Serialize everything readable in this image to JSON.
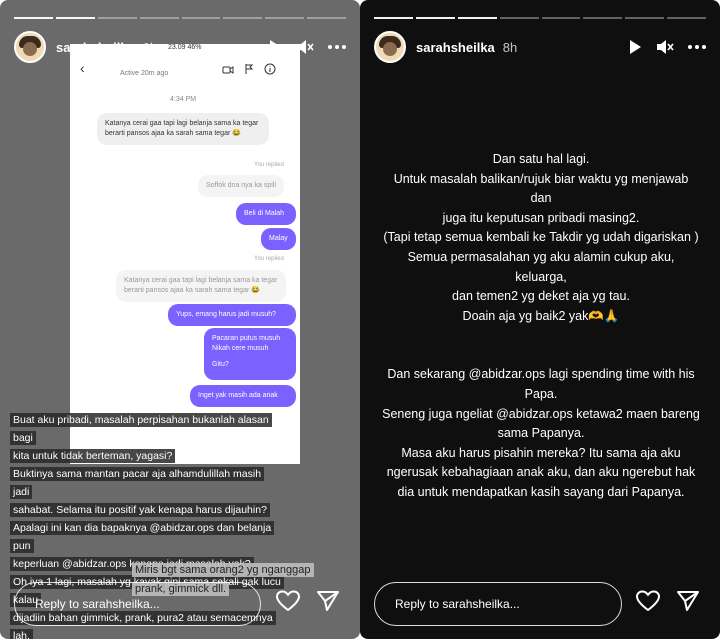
{
  "left": {
    "username": "sarahsheilka",
    "time": "9h",
    "phone_status": "23.09   46%",
    "chat": {
      "active": "Active 20m ago",
      "time_label": "4:34 PM",
      "m1": "Katanya cerai gaa tapi lagi belanja sama ka tegar berarti pansos ajaa ka sarah sama tegar 😂",
      "replied1": "You replied",
      "m2": "Soffok dna nya ka spill",
      "m3": "Beli di Malah",
      "m4": "Malay",
      "replied2": "You replied",
      "m5": "Katanya cerai gaa tapi lagi belanja sama ka tegar berarti pansos ajaa ka sarah sama tegar 😂",
      "m6": "Yups, emang harus jadi musuh?",
      "m7a": "Pacaran putus musuh",
      "m7b": "Nikah cere musuh",
      "m7c": "Gitu?",
      "m8": "Inget yak masih ada anak"
    },
    "caption_lines": [
      "Buat aku pribadi, masalah perpisahan bukanlah alasan bagi",
      "kita untuk tidak berteman, yagasi?",
      "Buktinya sama mantan pacar aja alhamdulillah masih jadi",
      "sahabat. Selama itu positif yak kenapa harus dijauhin?",
      "Apalagi ini kan dia bapaknya @abidzar.ops dan belanja pun",
      "keperluan @abidzar.ops kenapa jadi masalah yak?",
      "Oh iya 1 lagi, masalah yg kayak gini sama sekali gak lucu kalau",
      "dijadiin bahan gimmick, prank, pura2 atau semacemnya lah."
    ],
    "caption2_lines": [
      "Miris bgt sama orang2 yg nganggap",
      "prank, gimmick dll."
    ],
    "reply_placeholder": "Reply to sarahsheilka..."
  },
  "right": {
    "username": "sarahsheilka",
    "time": "8h",
    "paragraph1": [
      "Dan satu hal lagi.",
      "Untuk masalah balikan/rujuk biar waktu yg menjawab dan",
      "juga itu keputusan pribadi masing2.",
      "(Tapi tetap semua kembali ke Takdir yg udah digariskan )",
      "Semua permasalahan yg aku alamin cukup aku, keluarga,",
      "dan temen2 yg deket aja yg tau.",
      "Doain aja yg baik2 yak🫶🙏"
    ],
    "paragraph2": [
      "Dan sekarang @abidzar.ops lagi spending time with his",
      "Papa.",
      "Seneng juga ngeliat @abidzar.ops ketawa2 maen bareng",
      "sama Papanya.",
      "Masa aku harus pisahin mereka? Itu sama aja aku",
      "ngerusak kebahagiaan anak aku, dan aku ngerebut hak",
      "dia untuk mendapatkan kasih sayang dari Papanya."
    ],
    "reply_placeholder": "Reply to sarahsheilka..."
  },
  "icons": {
    "play": "play-icon",
    "mute": "mute-icon",
    "more": "more-icon",
    "heart": "heart-icon",
    "send": "send-icon"
  }
}
